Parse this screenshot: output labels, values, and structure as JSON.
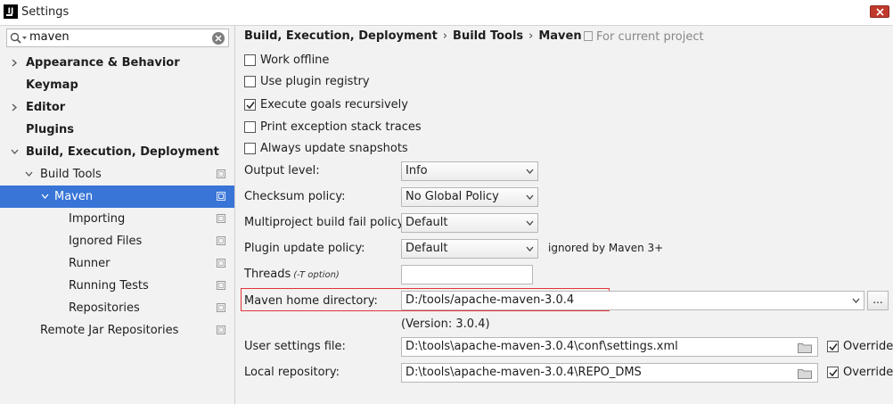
{
  "window": {
    "title": "Settings",
    "app_icon_text": "IJ"
  },
  "search": {
    "value": "maven"
  },
  "tree": [
    {
      "label": "Appearance & Behavior"
    },
    {
      "label": "Keymap"
    },
    {
      "label": "Editor"
    },
    {
      "label": "Plugins"
    },
    {
      "label": "Build, Execution, Deployment"
    },
    {
      "label": "Build Tools"
    },
    {
      "label": "Maven"
    },
    {
      "label": "Importing"
    },
    {
      "label": "Ignored Files"
    },
    {
      "label": "Runner"
    },
    {
      "label": "Running Tests"
    },
    {
      "label": "Repositories"
    },
    {
      "label": "Remote Jar Repositories"
    }
  ],
  "breadcrumb": {
    "part1": "Build, Execution, Deployment",
    "part2": "Build Tools",
    "part3": "Maven",
    "separator": "›",
    "scope": "For current project"
  },
  "checkboxes": [
    {
      "label": "Work offline",
      "checked": false
    },
    {
      "label": "Use plugin registry",
      "checked": false
    },
    {
      "label": "Execute goals recursively",
      "checked": true
    },
    {
      "label": "Print exception stack traces",
      "checked": false
    },
    {
      "label": "Always update snapshots",
      "checked": false
    }
  ],
  "fields": {
    "output_level": {
      "label": "Output level:",
      "value": "Info"
    },
    "checksum_policy": {
      "label": "Checksum policy:",
      "value": "No Global Policy"
    },
    "multiproject_fail": {
      "label": "Multiproject build fail policy:",
      "value": "Default"
    },
    "plugin_update": {
      "label": "Plugin update policy:",
      "value": "Default",
      "note": "ignored by Maven 3+"
    },
    "threads": {
      "label": "Threads",
      "hint": "(-T option)",
      "value": ""
    },
    "maven_home": {
      "label": "Maven home directory:",
      "value": "D:/tools/apache-maven-3.0.4",
      "browse": "...",
      "version": "(Version: 3.0.4)"
    },
    "user_settings": {
      "label": "User settings file:",
      "value": "D:\\tools\\apache-maven-3.0.4\\conf\\settings.xml",
      "override": "Override",
      "override_checked": true
    },
    "local_repo": {
      "label": "Local repository:",
      "value": "D:\\tools\\apache-maven-3.0.4\\REPO_DMS",
      "override": "Override",
      "override_checked": true
    }
  },
  "colors": {
    "selection": "#3875d7",
    "highlight_box": "#e0353a"
  }
}
